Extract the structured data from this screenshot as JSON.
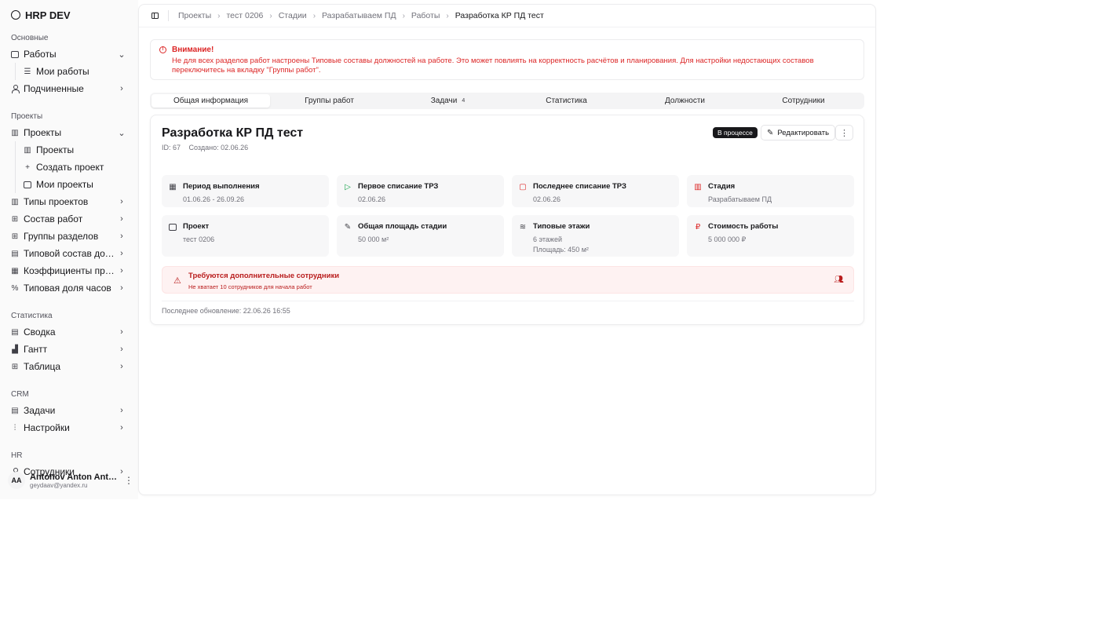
{
  "app": {
    "title": "HRP DEV"
  },
  "sidebar": {
    "groups": [
      {
        "label": "Основные"
      },
      {
        "label": "Проекты"
      },
      {
        "label": "Статистика"
      },
      {
        "label": "CRM"
      },
      {
        "label": "HR"
      }
    ],
    "works": {
      "label": "Работы",
      "icon": "briefcase-icon",
      "sub": [
        "Мои работы"
      ]
    },
    "subordinates": {
      "label": "Подчиненные",
      "icon": "user-icon"
    },
    "projects": {
      "label": "Проекты",
      "icon": "building-icon",
      "sub": [
        "Проекты",
        "Создать проект",
        "Мои проекты"
      ]
    },
    "items_projects": [
      {
        "label": "Типы проектов",
        "icon": "building-icon"
      },
      {
        "label": "Состав работ",
        "icon": "layout-icon"
      },
      {
        "label": "Группы разделов",
        "icon": "layout-icon"
      },
      {
        "label": "Типовой состав должност...",
        "icon": "clipboard-icon"
      },
      {
        "label": "Коэффициенты приведени...",
        "icon": "calculator-icon"
      },
      {
        "label": "Типовая доля часов",
        "icon": "percent-icon"
      }
    ],
    "items_stats": [
      {
        "label": "Сводка",
        "icon": "file-icon"
      },
      {
        "label": "Гантт",
        "icon": "chart-icon"
      },
      {
        "label": "Таблица",
        "icon": "table-icon"
      }
    ],
    "items_crm": [
      {
        "label": "Задачи",
        "icon": "clipboard-icon"
      },
      {
        "label": "Настройки",
        "icon": "sliders-icon"
      }
    ],
    "items_hr": [
      {
        "label": "Сотрудники",
        "icon": "users-icon"
      }
    ],
    "user": {
      "initials": "AA",
      "name": "Antonov Anton Antonovi...",
      "email": "geydaav@yandex.ru"
    }
  },
  "breadcrumb": [
    "Проекты",
    "тест 0206",
    "Стадии",
    "Разрабатываем ПД",
    "Работы"
  ],
  "breadcrumb_current": "Разработка КР ПД тест",
  "alert": {
    "title": "Внимание!",
    "text": "Не для всех разделов работ настроены Типовые составы должностей на работе. Это может повлиять на корректность расчётов и планирования. Для настройки недостающих составов переключитесь на вкладку \"Группы работ\"."
  },
  "tabs": [
    {
      "label": "Общая информация"
    },
    {
      "label": "Группы работ"
    },
    {
      "label": "Задачи",
      "count": "4"
    },
    {
      "label": "Статистика"
    },
    {
      "label": "Должности"
    },
    {
      "label": "Сотрудники"
    }
  ],
  "card": {
    "title": "Разработка КР ПД тест",
    "id": "ID: 67",
    "created": "Создано: 02.06.26",
    "status": "В процессе",
    "edit_label": "Редактировать",
    "tiles": [
      {
        "label": "Период выполнения",
        "value": "01.06.26 - 26.09.26",
        "icon": "calendar-icon",
        "color": "#3f3f46"
      },
      {
        "label": "Первое списание ТРЗ",
        "value": "02.06.26",
        "icon": "play-icon",
        "color": "#16a34a"
      },
      {
        "label": "Последнее списание ТРЗ",
        "value": "02.06.26",
        "icon": "stop-icon",
        "color": "#dc2626"
      },
      {
        "label": "Стадия",
        "value": "Разрабатываем ПД",
        "icon": "building-icon",
        "color": "#dc2626"
      },
      {
        "label": "Проект",
        "value": "тест 0206",
        "icon": "briefcase-icon",
        "color": "#3f3f46"
      },
      {
        "label": "Общая площадь стадии",
        "value": "50 000 м²",
        "icon": "ruler-icon",
        "color": "#3f3f46"
      },
      {
        "label": "Типовые этажи",
        "value": "6 этажей",
        "value2": "Площадь: 450 м²",
        "icon": "layers-icon",
        "color": "#3f3f46"
      },
      {
        "label": "Стоимость работы",
        "value": "5 000 000 ₽",
        "icon": "ruble-icon",
        "color": "#dc2626"
      }
    ],
    "warning": {
      "title": "Требуются дополнительные сотрудники",
      "text": "Не хватает 10 сотрудников для начала работ"
    },
    "updated": "Последнее обновление: 22.06.26 16:55"
  }
}
